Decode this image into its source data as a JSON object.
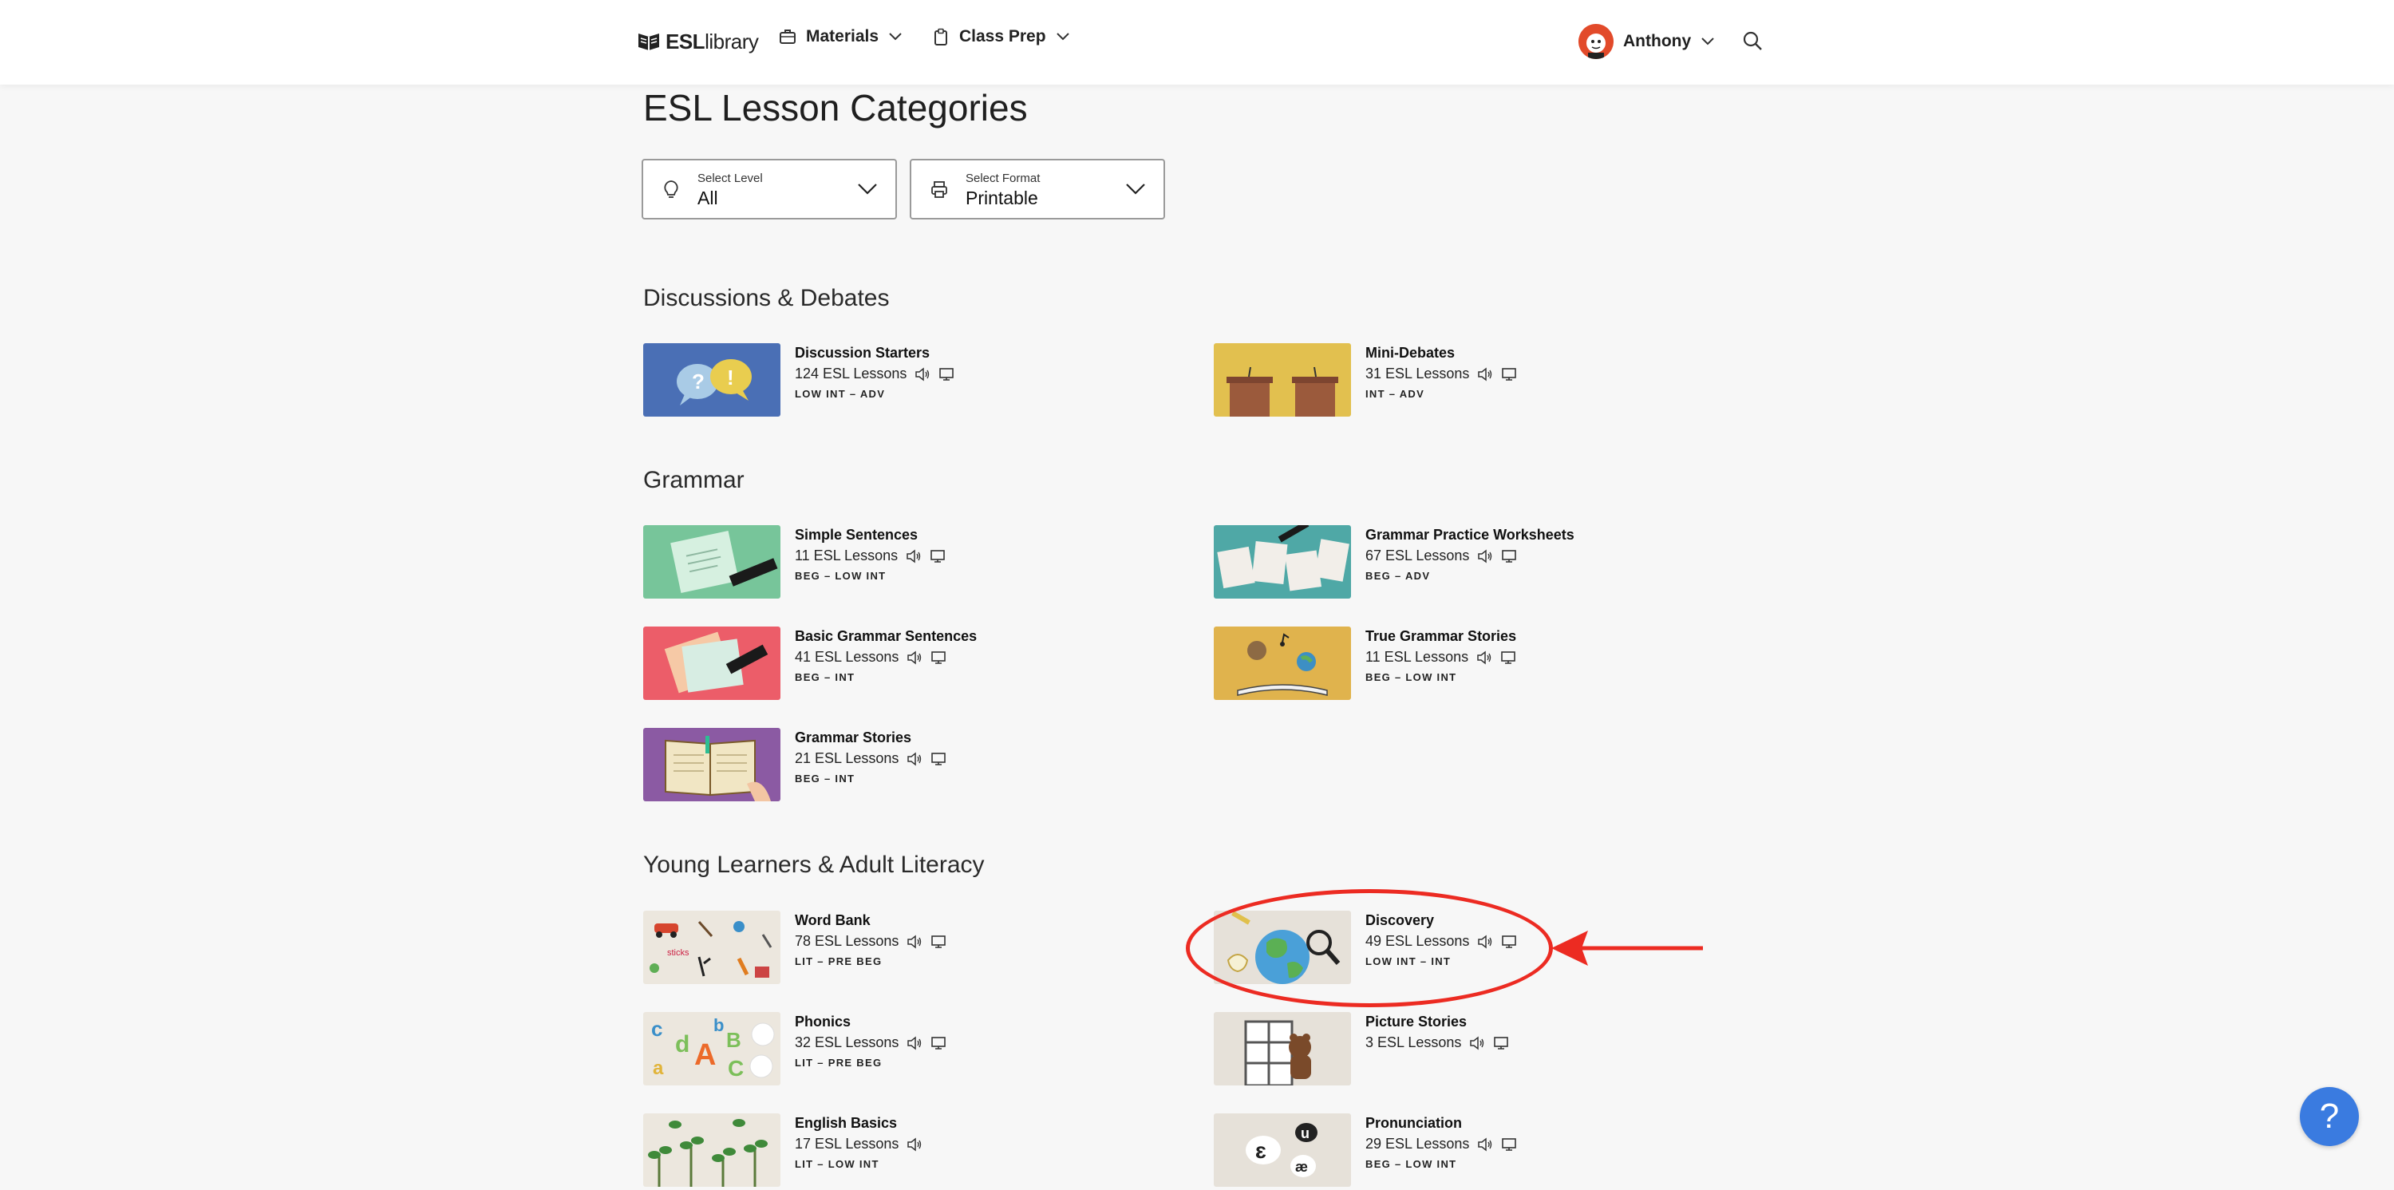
{
  "header": {
    "logo_bold": "ESL",
    "logo_rest": "library",
    "nav": [
      {
        "label": "Materials",
        "icon": "briefcase-icon"
      },
      {
        "label": "Class Prep",
        "icon": "clipboard-icon"
      }
    ],
    "user_name": "Anthony"
  },
  "page_title": "ESL Lesson Categories",
  "filters": {
    "level": {
      "label": "Select Level",
      "value": "All"
    },
    "format": {
      "label": "Select Format",
      "value": "Printable"
    }
  },
  "sections": [
    {
      "title": "Discussions & Debates",
      "items": [
        {
          "title": "Discussion Starters",
          "count": "124 ESL Lessons",
          "level": "LOW INT – ADV",
          "audio": true,
          "screen": true
        },
        {
          "title": "Mini-Debates",
          "count": "31 ESL Lessons",
          "level": "INT – ADV",
          "audio": true,
          "screen": true
        }
      ]
    },
    {
      "title": "Grammar",
      "items": [
        {
          "title": "Simple Sentences",
          "count": "11 ESL Lessons",
          "level": "BEG – LOW INT",
          "audio": true,
          "screen": true
        },
        {
          "title": "Grammar Practice Worksheets",
          "count": "67 ESL Lessons",
          "level": "BEG – ADV",
          "audio": true,
          "screen": true
        },
        {
          "title": "Basic Grammar Sentences",
          "count": "41 ESL Lessons",
          "level": "BEG – INT",
          "audio": true,
          "screen": true
        },
        {
          "title": "True Grammar Stories",
          "count": "11 ESL Lessons",
          "level": "BEG – LOW INT",
          "audio": true,
          "screen": true
        },
        {
          "title": "Grammar Stories",
          "count": "21 ESL Lessons",
          "level": "BEG – INT",
          "audio": true,
          "screen": true
        }
      ]
    },
    {
      "title": "Young Learners & Adult Literacy",
      "items": [
        {
          "title": "Word Bank",
          "count": "78 ESL Lessons",
          "level": "LIT – PRE BEG",
          "audio": true,
          "screen": true
        },
        {
          "title": "Discovery",
          "count": "49 ESL Lessons",
          "level": "LOW INT – INT",
          "audio": true,
          "screen": true
        },
        {
          "title": "Phonics",
          "count": "32 ESL Lessons",
          "level": "LIT – PRE BEG",
          "audio": true,
          "screen": true
        },
        {
          "title": "Picture Stories",
          "count": "3 ESL Lessons",
          "level": "",
          "audio": true,
          "screen": true
        },
        {
          "title": "English Basics",
          "count": "17 ESL Lessons",
          "level": "LIT – LOW INT",
          "audio": true,
          "screen": false
        },
        {
          "title": "Pronunciation",
          "count": "29 ESL Lessons",
          "level": "BEG – LOW INT",
          "audio": true,
          "screen": true
        }
      ]
    }
  ],
  "help_label": "?",
  "colors": {
    "annotation": "#ec2b22",
    "help": "#3a7be0"
  }
}
